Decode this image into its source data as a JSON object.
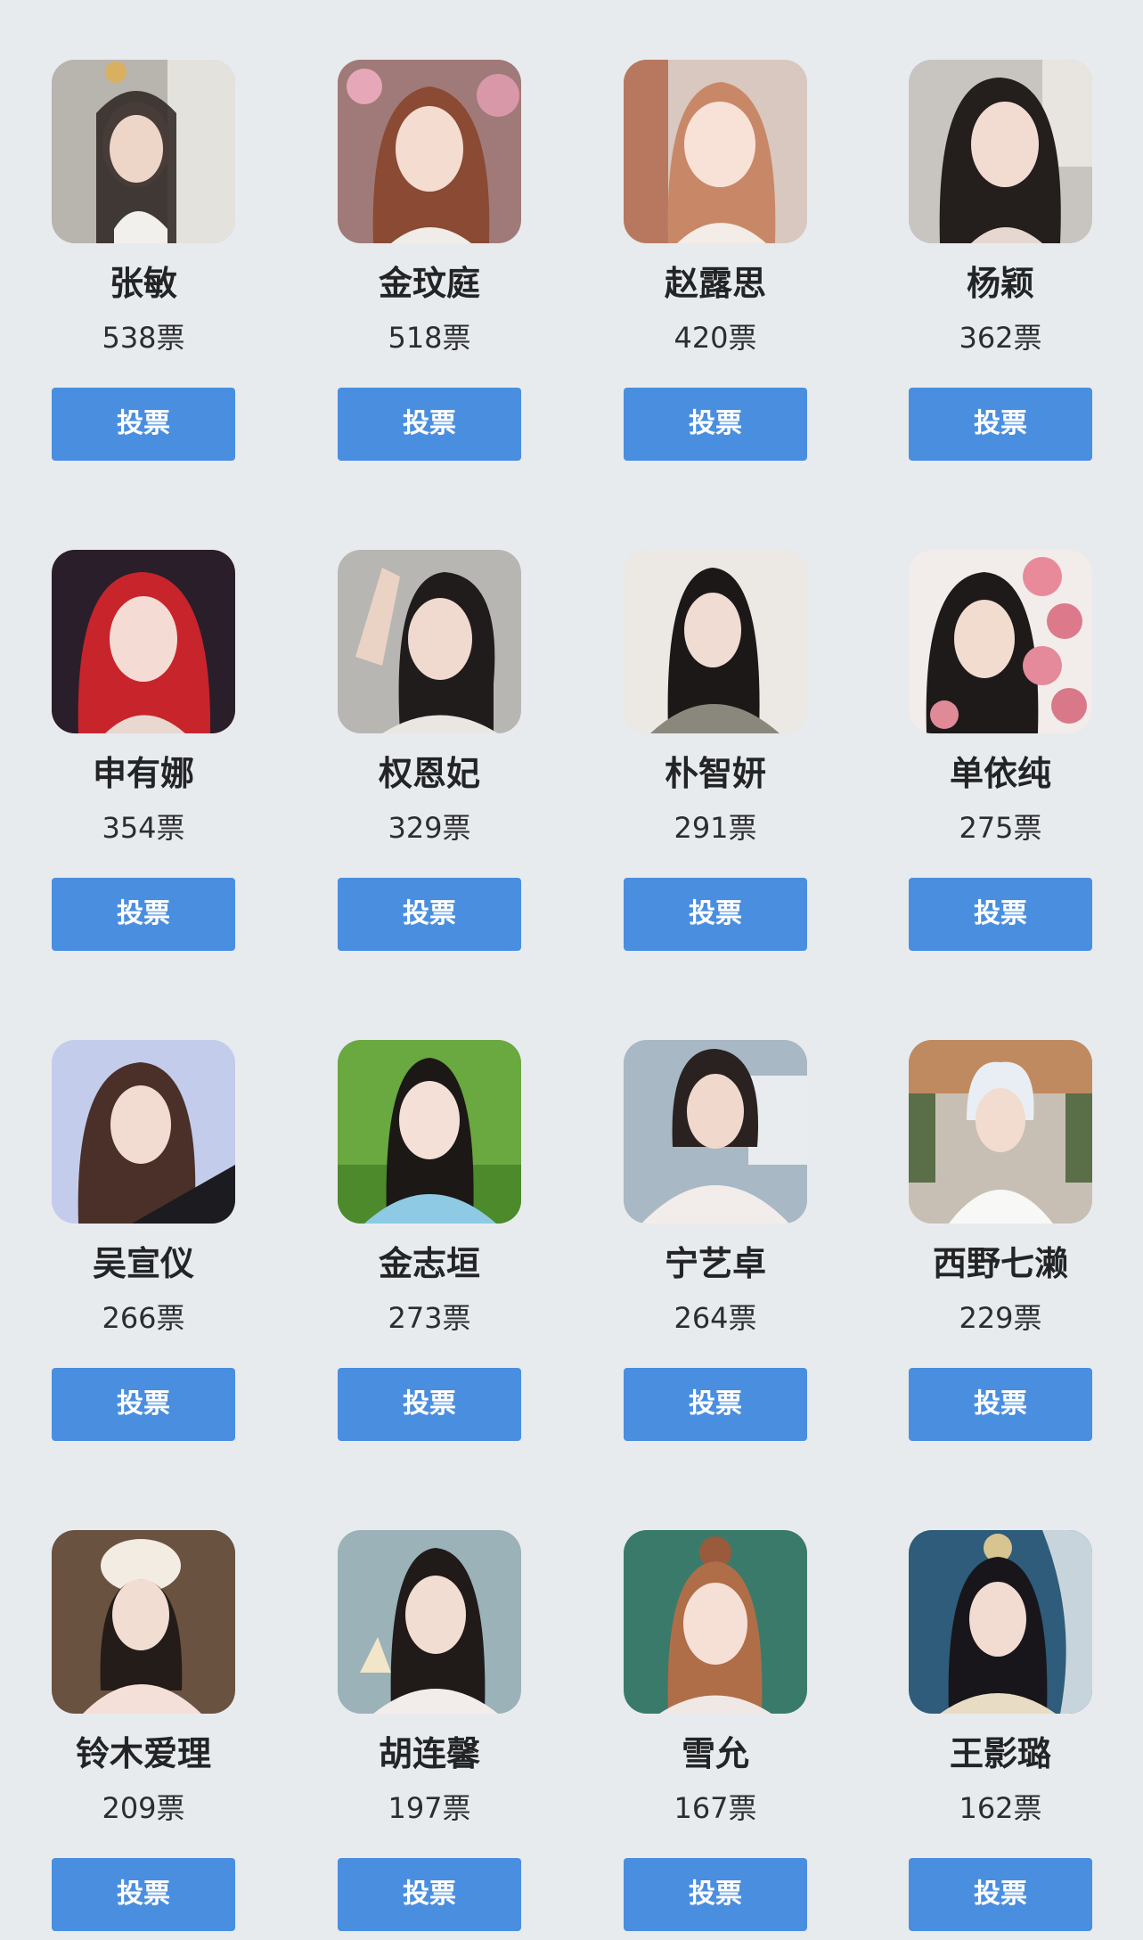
{
  "vote_button_label": "投票",
  "accent_color": "#4a8ee0",
  "candidates": [
    {
      "name": "张敏",
      "votes": "538票"
    },
    {
      "name": "金玟庭",
      "votes": "518票"
    },
    {
      "name": "赵露思",
      "votes": "420票"
    },
    {
      "name": "杨颖",
      "votes": "362票"
    },
    {
      "name": "申有娜",
      "votes": "354票"
    },
    {
      "name": "权恩妃",
      "votes": "329票"
    },
    {
      "name": "朴智妍",
      "votes": "291票"
    },
    {
      "name": "单依纯",
      "votes": "275票"
    },
    {
      "name": "吴宣仪",
      "votes": "266票"
    },
    {
      "name": "金志垣",
      "votes": "273票"
    },
    {
      "name": "宁艺卓",
      "votes": "264票"
    },
    {
      "name": "西野七濑",
      "votes": "229票"
    },
    {
      "name": "铃木爱理",
      "votes": "209票"
    },
    {
      "name": "胡连馨",
      "votes": "197票"
    },
    {
      "name": "雪允",
      "votes": "167票"
    },
    {
      "name": "王影璐",
      "votes": "162票"
    }
  ]
}
